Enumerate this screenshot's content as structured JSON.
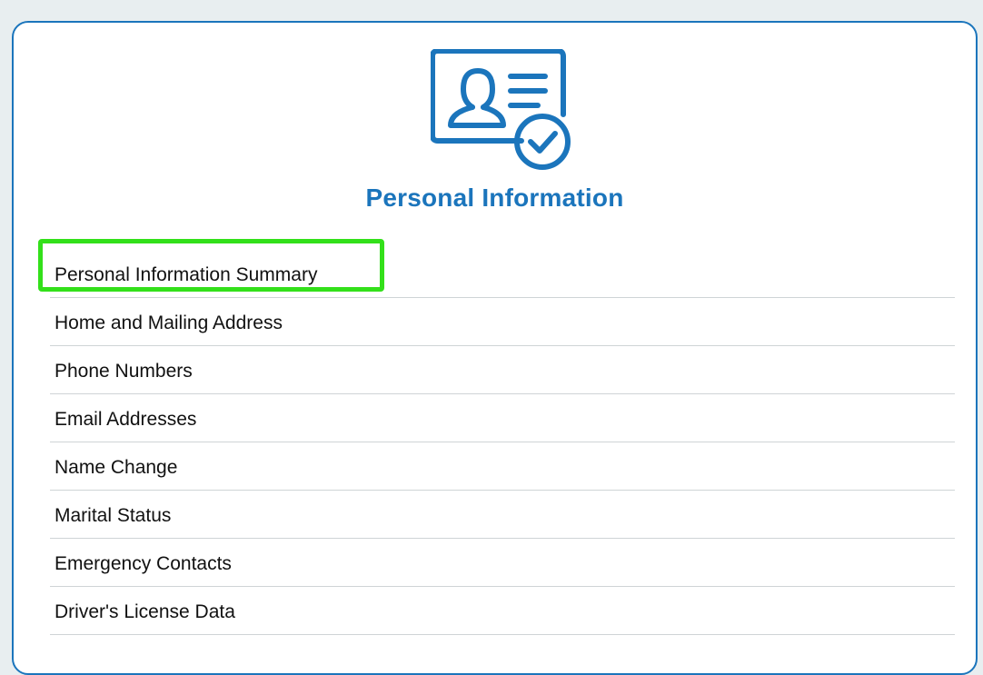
{
  "header": {
    "icon": "id-card-check-icon",
    "title": "Personal Information"
  },
  "menu": {
    "items": [
      {
        "label": "Personal Information Summary",
        "highlighted": true
      },
      {
        "label": "Home and Mailing Address"
      },
      {
        "label": "Phone Numbers"
      },
      {
        "label": "Email Addresses"
      },
      {
        "label": "Name Change"
      },
      {
        "label": "Marital Status"
      },
      {
        "label": "Emergency Contacts"
      },
      {
        "label": "Driver's License Data"
      }
    ]
  },
  "colors": {
    "accent": "#1b75bc",
    "highlight": "#33e01a",
    "divider": "#cfd4d6",
    "page_background": "#e8eef0"
  }
}
